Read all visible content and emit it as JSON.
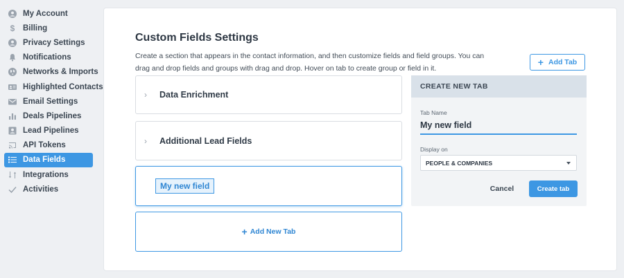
{
  "sidebar": {
    "items": [
      {
        "label": "My Account",
        "icon": "user-icon"
      },
      {
        "label": "Billing",
        "icon": "dollar-icon"
      },
      {
        "label": "Privacy Settings",
        "icon": "user-icon"
      },
      {
        "label": "Notifications",
        "icon": "bell-icon"
      },
      {
        "label": "Networks & Imports",
        "icon": "globe-icon"
      },
      {
        "label": "Highlighted Contacts",
        "icon": "contact-card-icon"
      },
      {
        "label": "Email Settings",
        "icon": "envelope-icon"
      },
      {
        "label": "Deals Pipelines",
        "icon": "bar-chart-icon"
      },
      {
        "label": "Lead Pipelines",
        "icon": "id-card-icon"
      },
      {
        "label": "API Tokens",
        "icon": "cast-icon"
      },
      {
        "label": "Data Fields",
        "icon": "list-icon",
        "active": true
      },
      {
        "label": "Integrations",
        "icon": "integrations-icon"
      },
      {
        "label": "Activities",
        "icon": "check-icon"
      }
    ]
  },
  "main": {
    "title": "Custom Fields Settings",
    "description": "Create a section that appears in the contact information, and then customize fields and field groups. You can drag and drop fields and groups with drag and drop. Hover on tab to create group or field in it.",
    "add_tab_label": "Add Tab",
    "sections": [
      {
        "label": "Data Enrichment"
      },
      {
        "label": "Additional Lead Fields"
      },
      {
        "label": "My new field",
        "editing": true
      }
    ],
    "add_new_tab_label": "Add New Tab"
  },
  "panel": {
    "title": "CREATE NEW TAB",
    "tab_name_label": "Tab Name",
    "tab_name_value": "My new field",
    "display_on_label": "Display on",
    "display_on_value": "PEOPLE & COMPANIES",
    "cancel_label": "Cancel",
    "create_label": "Create tab"
  },
  "colors": {
    "accent": "#3d97e3",
    "panel_header": "#d9e1e9",
    "background": "#eef0f3"
  }
}
